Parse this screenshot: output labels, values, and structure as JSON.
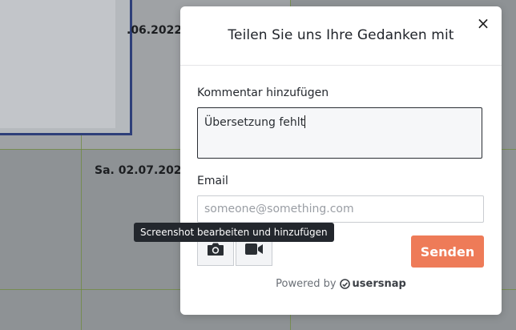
{
  "background": {
    "dates": [
      "_.06.2022",
      "Sa. 02.07.2022"
    ]
  },
  "dialog": {
    "title": "Teilen Sie uns Ihre Gedanken mit",
    "close_symbol": "×",
    "comment": {
      "label": "Kommentar hinzufügen",
      "value": "Übersetzung fehlt"
    },
    "email": {
      "label": "Email",
      "value": "",
      "placeholder": "someone@something.com"
    },
    "tools": {
      "screenshot_icon": "camera-icon",
      "video_icon": "video-camera-icon",
      "tooltip": "Screenshot bearbeiten und hinzufügen"
    },
    "send_label": "Senden",
    "footer": {
      "powered_by": "Powered by",
      "brand": "usersnap"
    }
  },
  "colors": {
    "accent": "#ee7b58",
    "overlay": "#8e9295",
    "frame_border": "#2e3f79",
    "grid_lines": "#6e8a3c"
  }
}
